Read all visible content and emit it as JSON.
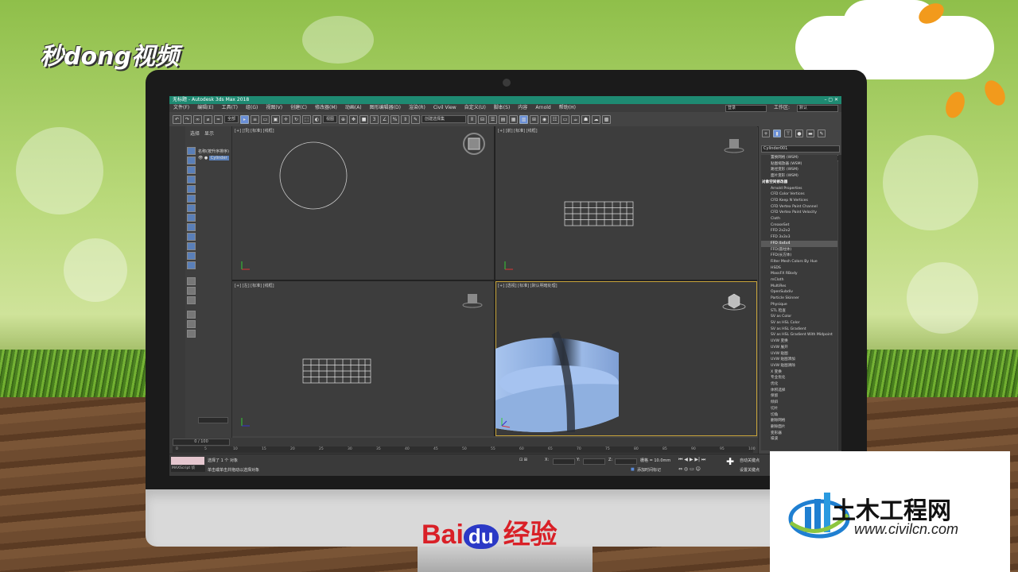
{
  "background": {
    "logo_text": "秒dong视频"
  },
  "window": {
    "title": "无标题 - Autodesk 3ds Max 2018"
  },
  "menu": [
    "文件(F)",
    "编辑(E)",
    "工具(T)",
    "组(G)",
    "视图(V)",
    "创建(C)",
    "修改器(M)",
    "动画(A)",
    "图形编辑器(D)",
    "渲染(R)",
    "Civil View",
    "自定义(U)",
    "脚本(S)",
    "内容",
    "Arnold",
    "帮助(H)"
  ],
  "menu_right": {
    "login": "登录",
    "workspace_label": "工作区:",
    "workspace_value": "默认"
  },
  "toolbar": {
    "filter_value": "全部",
    "view_value": "视图",
    "selection_set": "创建选择集"
  },
  "scene_explorer": {
    "tab_select": "选择",
    "tab_display": "显示",
    "sort_header": "名称(按升序排序)",
    "object_name": "Cylinder"
  },
  "viewports": {
    "top": "[+] [顶] [标准] [线框]",
    "front": "[+] [前] [标准] [线框]",
    "left": "[+] [左] [标准] [线框]",
    "perspective": "[+] [透视] [标准] [默认明暗处理]"
  },
  "command_panel": {
    "object_name": "Cylinder001",
    "modifiers": [
      {
        "label": "置换网格 (WSM)",
        "type": "item"
      },
      {
        "label": "贴图缩放器 (WSM)",
        "type": "item"
      },
      {
        "label": "路径变形 (WSM)",
        "type": "item"
      },
      {
        "label": "面片变形 (WSM)",
        "type": "item"
      },
      {
        "label": "对象空间修改器",
        "type": "hdr"
      },
      {
        "label": "Arnold Properties",
        "type": "item"
      },
      {
        "label": "CFD Color Vertices",
        "type": "item"
      },
      {
        "label": "CFD Keep N Vertices",
        "type": "item"
      },
      {
        "label": "CFD Vertex Paint Channel",
        "type": "item"
      },
      {
        "label": "CFD Vertex Paint Velocity",
        "type": "item"
      },
      {
        "label": "Cloth",
        "type": "item"
      },
      {
        "label": "CreaseSet",
        "type": "item"
      },
      {
        "label": "FFD 2x2x2",
        "type": "item"
      },
      {
        "label": "FFD 3x3x3",
        "type": "item"
      },
      {
        "label": "FFD 4x4x4",
        "type": "sel"
      },
      {
        "label": "FFD(圆柱体)",
        "type": "item"
      },
      {
        "label": "FFD(长方体)",
        "type": "item"
      },
      {
        "label": "Filter Mesh Colors By Hue",
        "type": "item"
      },
      {
        "label": "HSDS",
        "type": "item"
      },
      {
        "label": "MassFX RBody",
        "type": "item"
      },
      {
        "label": "mCloth",
        "type": "item"
      },
      {
        "label": "MultiRes",
        "type": "item"
      },
      {
        "label": "OpenSubdiv",
        "type": "item"
      },
      {
        "label": "Particle Skinner",
        "type": "item"
      },
      {
        "label": "Physique",
        "type": "item"
      },
      {
        "label": "STL 检查",
        "type": "item"
      },
      {
        "label": "SV as Color",
        "type": "item"
      },
      {
        "label": "SV as HSL Color",
        "type": "item"
      },
      {
        "label": "SV as HSL Gradient",
        "type": "item"
      },
      {
        "label": "SV as HSL Gradient With Midpoint",
        "type": "item"
      },
      {
        "label": "UVW 变换",
        "type": "item"
      },
      {
        "label": "UVW 展开",
        "type": "item"
      },
      {
        "label": "UVW 贴图",
        "type": "item"
      },
      {
        "label": "UVW 贴图添加",
        "type": "item"
      },
      {
        "label": "UVW 贴图清除",
        "type": "item"
      },
      {
        "label": "X 变换",
        "type": "item"
      },
      {
        "label": "专业优化",
        "type": "item"
      },
      {
        "label": "优化",
        "type": "item"
      },
      {
        "label": "体积选择",
        "type": "item"
      },
      {
        "label": "保留",
        "type": "item"
      },
      {
        "label": "倾斜",
        "type": "item"
      },
      {
        "label": "切片",
        "type": "item"
      },
      {
        "label": "切角",
        "type": "item"
      },
      {
        "label": "删除网格",
        "type": "item"
      },
      {
        "label": "删除面片",
        "type": "item"
      },
      {
        "label": "变形器",
        "type": "item"
      },
      {
        "label": "噪波",
        "type": "item"
      }
    ]
  },
  "timeline": {
    "frame": "0 / 100",
    "ticks": [
      "0",
      "5",
      "10",
      "15",
      "20",
      "25",
      "30",
      "35",
      "40",
      "45",
      "50",
      "55",
      "60",
      "65",
      "70",
      "75",
      "80",
      "85",
      "90",
      "95",
      "100"
    ]
  },
  "status": {
    "selected": "选择了 1 个 对象",
    "hint": "单击或单击并拖动以选择对象",
    "maxscript": "MAXScript 侦",
    "x_label": "X:",
    "y_label": "Y:",
    "z_label": "Z:",
    "grid": "栅格 = 10.0mm",
    "add_time_tag": "添加时间标记",
    "autokey": "自动关键点",
    "set_key": "设置关键点"
  },
  "branding": {
    "baidu_text": "Bai",
    "baidu_du": "du",
    "baidu_cn": "经验"
  },
  "watermark": {
    "title": "土木工程网",
    "url": "www.civilcn.com"
  },
  "colors": {
    "title_bar": "#1e8a72",
    "accent_blue": "#6a8fd6",
    "cylinder": "#8fb0e0",
    "active_border": "#c8a43a"
  }
}
